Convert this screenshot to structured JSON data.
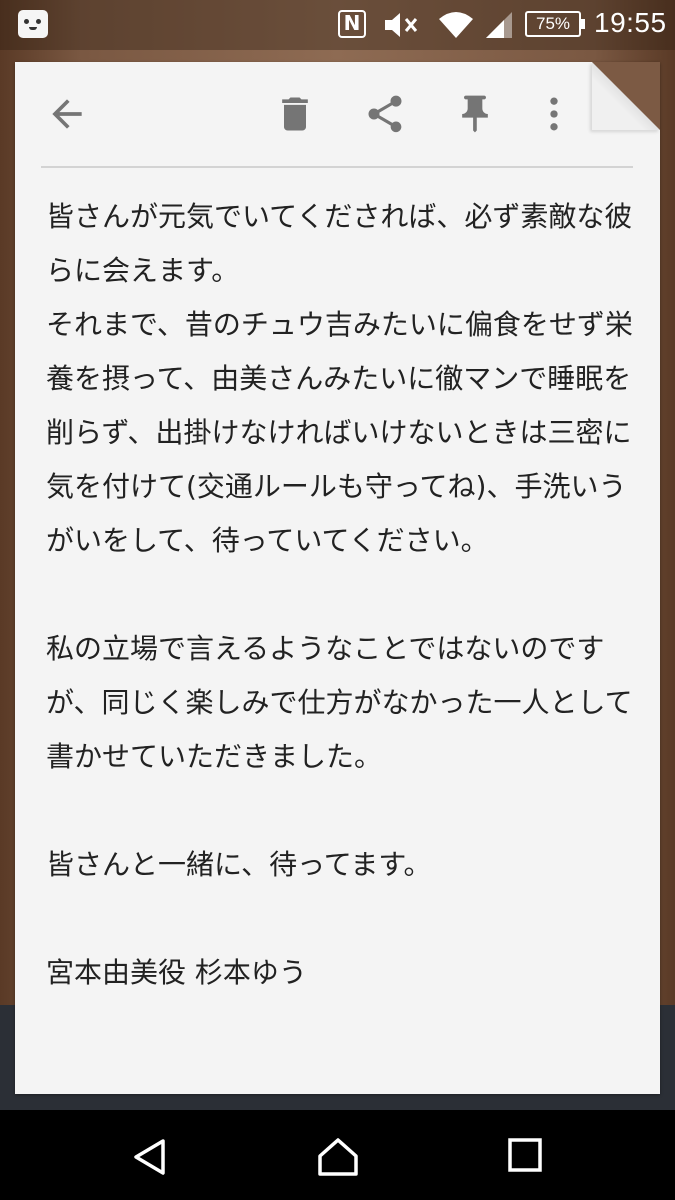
{
  "status_bar": {
    "time": "19:55",
    "battery_percent": "75%",
    "nfc_label": "N",
    "icons": [
      "app-notification-icon",
      "nfc-icon",
      "volume-mute-icon",
      "wifi-icon",
      "cell-signal-icon",
      "battery-icon"
    ]
  },
  "toolbar": {
    "icons": [
      "back-arrow-icon",
      "delete-icon",
      "share-icon",
      "pin-icon",
      "more-vert-icon"
    ]
  },
  "note": {
    "paragraphs": [
      "皆さんが元気でいてくだされば、必ず素敵な彼らに会えます。\nそれまで、昔のチュウ吉みたいに偏食をせず栄養を摂って、由美さんみたいに徹マンで睡眠を削らず、出掛けなければいけないときは三密に気を付けて(交通ルールも守ってね)、手洗いうがいをして、待っていてください。",
      "私の立場で言えるようなことではないのですが、同じく楽しみで仕方がなかった一人として書かせていただきました。",
      "皆さんと一緒に、待ってます。",
      "宮本由美役 杉本ゆう"
    ]
  },
  "nav_bar": {
    "icons": [
      "nav-back-icon",
      "nav-home-icon",
      "nav-recents-icon"
    ]
  },
  "colors": {
    "card": "#f4f4f4",
    "text": "#222222",
    "icon": "#757575",
    "wallpaper": "#7a5842"
  }
}
